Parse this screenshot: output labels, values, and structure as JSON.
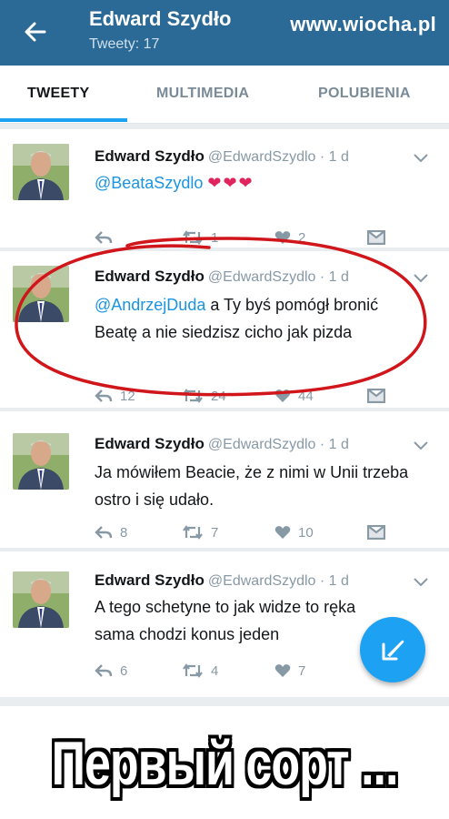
{
  "header": {
    "title": "Edward Szydło",
    "subtitle": "Tweety: 17",
    "watermark": "www.wiocha.pl"
  },
  "tabs": [
    {
      "label": "TWEETY",
      "active": true
    },
    {
      "label": "MULTIMEDIA",
      "active": false
    },
    {
      "label": "POLUBIENIA",
      "active": false
    }
  ],
  "tweets": [
    {
      "name": "Edward Szydło",
      "handle": "@EdwardSzydlo · 1 d",
      "mention": "@BeataSzydlo",
      "text": "",
      "hearts": "❤❤❤",
      "replies": "",
      "retweets": "1",
      "likes": "2"
    },
    {
      "name": "Edward Szydło",
      "handle": "@EdwardSzydlo · 1 d",
      "mention": "@AndrzejDuda",
      "text": " a Ty byś pomógł bronić Beatę a nie siedzisz cicho jak pizda",
      "replies": "12",
      "retweets": "24",
      "likes": "44"
    },
    {
      "name": "Edward Szydło",
      "handle": "@EdwardSzydlo · 1 d",
      "mention": "",
      "text": "Ja mówiłem Beacie, że z nimi w Unii trzeba ostro i się udało.",
      "replies": "8",
      "retweets": "7",
      "likes": "10"
    },
    {
      "name": "Edward Szydło",
      "handle": "@EdwardSzydlo · 1 d",
      "mention": "",
      "text": "A tego schetyne to jak widze to ręka sama chodzi konus jeden",
      "replies": "6",
      "retweets": "4",
      "likes": "7"
    }
  ],
  "caption": "Первый сорт ...",
  "colors": {
    "header": "#2b6a96",
    "accent": "#1da1f2",
    "annotation": "#d0161b"
  },
  "icons": [
    "back-arrow-icon",
    "chevron-down-icon",
    "reply-icon",
    "retweet-icon",
    "like-icon",
    "direct-message-icon",
    "compose-icon"
  ]
}
